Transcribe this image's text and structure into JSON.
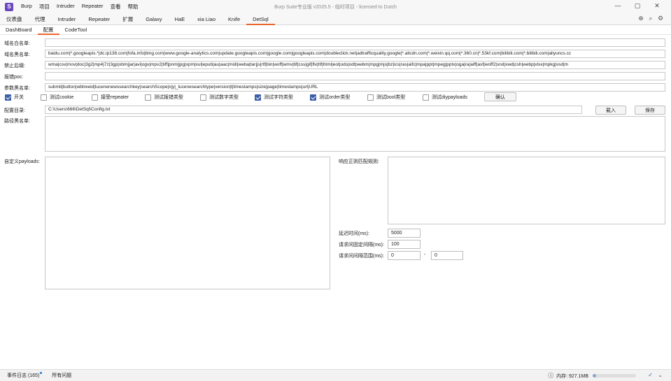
{
  "app": {
    "logo": "S",
    "title": "Burp Suite专业版  v2025.5 - 临时项目 - licensed to Dutch"
  },
  "menu": [
    "Burp",
    "项目",
    "Intruder",
    "Repeater",
    "查看",
    "帮助"
  ],
  "window_controls": [
    "—",
    "▢",
    "✕"
  ],
  "tools": {
    "globe": "⊕",
    "search": "⌕",
    "gear": "⚙"
  },
  "main_tabs": [
    "仪表盘",
    "代理",
    "Intruder",
    "Repeater",
    "扩展",
    "Galaxy",
    "HaE",
    "xia Liao",
    "Knife",
    "DetSql"
  ],
  "active_main_tab": "DetSql",
  "sub_tabs": [
    "DashBoard",
    "配置",
    "CodeTool"
  ],
  "active_sub_tab": "配置",
  "form": {
    "whitelist_domains": {
      "label": "域名白名单:",
      "value": ""
    },
    "blacklist_domains": {
      "label": "域名黑名单:",
      "value": "baidu.com|*.googleapis.*|dc.ip138.com|fofa.info|bing.com|www.google-analytics.com|update.googleapis.com|google.com|googleapis.com|doubleclick.net|adtrafficquality.google|*.alicdn.com|*.weixin.qq.com|*.360.cn|*.53kf.com|bilibili.com|*.bilibili.com|aliyuncs.cc"
    },
    "forbidden_suffix": {
      "label": "禁止后缀:",
      "value": "wma|csv|mov|doc|3g2|mp4|7z|3gp|xbm|jar|avi|ogv|mpv2|tiff|pnm|jpg|xpm|xul|epub|au|aac|midi|weba|tar|js|rtf|bin|woff|wmv|tif|css|gif|flv|ttf|html|eot|ods|odt|webm|mpg|mjs|bz|ics|ras|aifc|mpa|ppt|mpeg|pptx|oga|ra|aiff|asf|woff2|snd|xwd|csh|webp|xlsx|mpkg|vsd|m"
    },
    "error_poc": {
      "label": "报错poc:",
      "value": ""
    },
    "param_blacklist": {
      "label": "参数黑名单:",
      "value": "submit|button|wbtreeid|lucenenewssearchkey|searchScope|x|y|_lucenesearchtype|version|t|timestamps|size|page|timestamps|url|URL"
    }
  },
  "options": [
    {
      "label": "开关",
      "checked": true
    },
    {
      "label": "测试cookie",
      "checked": false
    },
    {
      "label": "接受repeater",
      "checked": false
    },
    {
      "label": "测试报错类型",
      "checked": false
    },
    {
      "label": "测试数字类型",
      "checked": false
    },
    {
      "label": "测试字符类型",
      "checked": true
    },
    {
      "label": "测试order类型",
      "checked": true
    },
    {
      "label": "测试bool类型",
      "checked": false
    },
    {
      "label": "测试diypayloads",
      "checked": false
    }
  ],
  "confirm_label": "确认",
  "config": {
    "label": "配置目录:",
    "path": "C:\\Users\\666\\DetSql\\Config.txt",
    "load_label": "载入",
    "save_label": "保存"
  },
  "path_blacklist_label": "路径黑名单:",
  "diy_payloads_label": "自定义payloads:",
  "regex_label": "响应正则匹配规则:",
  "timing": {
    "delay_label": "延迟时间(ms):",
    "delay_value": "5000",
    "interval_label": "请求间固定间隔(ms):",
    "interval_value": "100",
    "range_label": "请求间间隔范围(ms):",
    "range_min": "0",
    "range_sep": "-",
    "range_max": "0"
  },
  "status": {
    "event_log": "事件日志 (165)",
    "all_issues": "所有问题",
    "memory": "内存: 927.1MB",
    "memory_fraction": 0.08
  }
}
